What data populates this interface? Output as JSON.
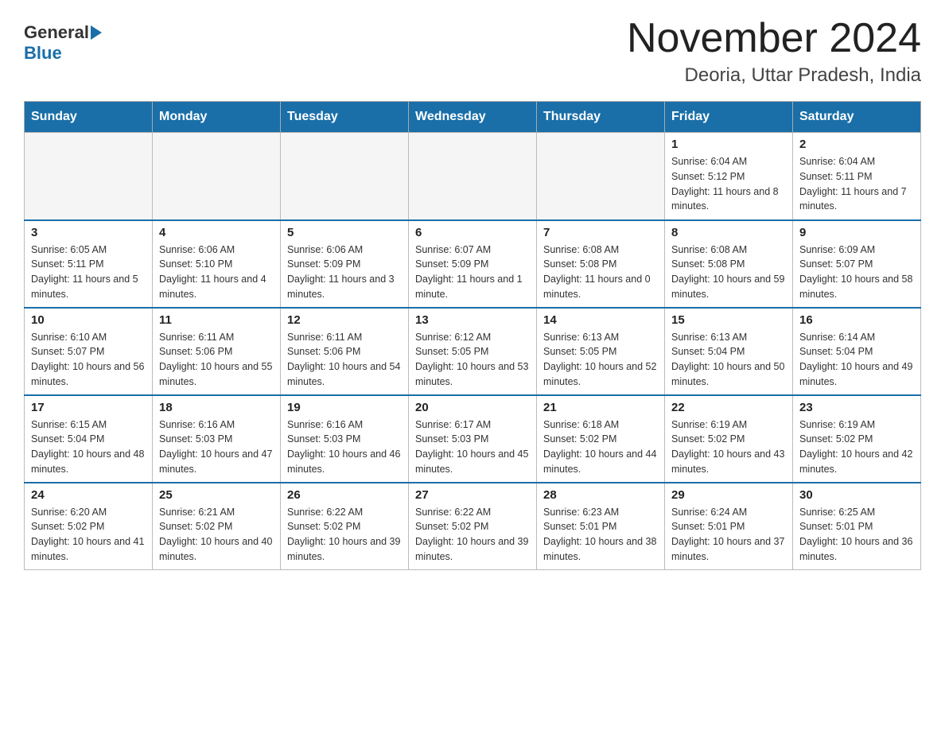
{
  "header": {
    "title": "November 2024",
    "subtitle": "Deoria, Uttar Pradesh, India",
    "logo_general": "General",
    "logo_blue": "Blue"
  },
  "weekdays": [
    "Sunday",
    "Monday",
    "Tuesday",
    "Wednesday",
    "Thursday",
    "Friday",
    "Saturday"
  ],
  "weeks": [
    [
      {
        "day": "",
        "info": ""
      },
      {
        "day": "",
        "info": ""
      },
      {
        "day": "",
        "info": ""
      },
      {
        "day": "",
        "info": ""
      },
      {
        "day": "",
        "info": ""
      },
      {
        "day": "1",
        "info": "Sunrise: 6:04 AM\nSunset: 5:12 PM\nDaylight: 11 hours and 8 minutes."
      },
      {
        "day": "2",
        "info": "Sunrise: 6:04 AM\nSunset: 5:11 PM\nDaylight: 11 hours and 7 minutes."
      }
    ],
    [
      {
        "day": "3",
        "info": "Sunrise: 6:05 AM\nSunset: 5:11 PM\nDaylight: 11 hours and 5 minutes."
      },
      {
        "day": "4",
        "info": "Sunrise: 6:06 AM\nSunset: 5:10 PM\nDaylight: 11 hours and 4 minutes."
      },
      {
        "day": "5",
        "info": "Sunrise: 6:06 AM\nSunset: 5:09 PM\nDaylight: 11 hours and 3 minutes."
      },
      {
        "day": "6",
        "info": "Sunrise: 6:07 AM\nSunset: 5:09 PM\nDaylight: 11 hours and 1 minute."
      },
      {
        "day": "7",
        "info": "Sunrise: 6:08 AM\nSunset: 5:08 PM\nDaylight: 11 hours and 0 minutes."
      },
      {
        "day": "8",
        "info": "Sunrise: 6:08 AM\nSunset: 5:08 PM\nDaylight: 10 hours and 59 minutes."
      },
      {
        "day": "9",
        "info": "Sunrise: 6:09 AM\nSunset: 5:07 PM\nDaylight: 10 hours and 58 minutes."
      }
    ],
    [
      {
        "day": "10",
        "info": "Sunrise: 6:10 AM\nSunset: 5:07 PM\nDaylight: 10 hours and 56 minutes."
      },
      {
        "day": "11",
        "info": "Sunrise: 6:11 AM\nSunset: 5:06 PM\nDaylight: 10 hours and 55 minutes."
      },
      {
        "day": "12",
        "info": "Sunrise: 6:11 AM\nSunset: 5:06 PM\nDaylight: 10 hours and 54 minutes."
      },
      {
        "day": "13",
        "info": "Sunrise: 6:12 AM\nSunset: 5:05 PM\nDaylight: 10 hours and 53 minutes."
      },
      {
        "day": "14",
        "info": "Sunrise: 6:13 AM\nSunset: 5:05 PM\nDaylight: 10 hours and 52 minutes."
      },
      {
        "day": "15",
        "info": "Sunrise: 6:13 AM\nSunset: 5:04 PM\nDaylight: 10 hours and 50 minutes."
      },
      {
        "day": "16",
        "info": "Sunrise: 6:14 AM\nSunset: 5:04 PM\nDaylight: 10 hours and 49 minutes."
      }
    ],
    [
      {
        "day": "17",
        "info": "Sunrise: 6:15 AM\nSunset: 5:04 PM\nDaylight: 10 hours and 48 minutes."
      },
      {
        "day": "18",
        "info": "Sunrise: 6:16 AM\nSunset: 5:03 PM\nDaylight: 10 hours and 47 minutes."
      },
      {
        "day": "19",
        "info": "Sunrise: 6:16 AM\nSunset: 5:03 PM\nDaylight: 10 hours and 46 minutes."
      },
      {
        "day": "20",
        "info": "Sunrise: 6:17 AM\nSunset: 5:03 PM\nDaylight: 10 hours and 45 minutes."
      },
      {
        "day": "21",
        "info": "Sunrise: 6:18 AM\nSunset: 5:02 PM\nDaylight: 10 hours and 44 minutes."
      },
      {
        "day": "22",
        "info": "Sunrise: 6:19 AM\nSunset: 5:02 PM\nDaylight: 10 hours and 43 minutes."
      },
      {
        "day": "23",
        "info": "Sunrise: 6:19 AM\nSunset: 5:02 PM\nDaylight: 10 hours and 42 minutes."
      }
    ],
    [
      {
        "day": "24",
        "info": "Sunrise: 6:20 AM\nSunset: 5:02 PM\nDaylight: 10 hours and 41 minutes."
      },
      {
        "day": "25",
        "info": "Sunrise: 6:21 AM\nSunset: 5:02 PM\nDaylight: 10 hours and 40 minutes."
      },
      {
        "day": "26",
        "info": "Sunrise: 6:22 AM\nSunset: 5:02 PM\nDaylight: 10 hours and 39 minutes."
      },
      {
        "day": "27",
        "info": "Sunrise: 6:22 AM\nSunset: 5:02 PM\nDaylight: 10 hours and 39 minutes."
      },
      {
        "day": "28",
        "info": "Sunrise: 6:23 AM\nSunset: 5:01 PM\nDaylight: 10 hours and 38 minutes."
      },
      {
        "day": "29",
        "info": "Sunrise: 6:24 AM\nSunset: 5:01 PM\nDaylight: 10 hours and 37 minutes."
      },
      {
        "day": "30",
        "info": "Sunrise: 6:25 AM\nSunset: 5:01 PM\nDaylight: 10 hours and 36 minutes."
      }
    ]
  ]
}
